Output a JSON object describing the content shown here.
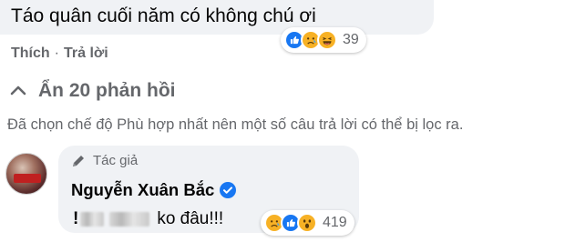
{
  "top_comment": {
    "text": "Táo quân cuối năm có không chú ơi",
    "actions": {
      "like": "Thích",
      "separator": "·",
      "reply": "Trả lời"
    },
    "reactions": {
      "icons": [
        "like-icon",
        "sad-icon",
        "haha-icon"
      ],
      "count": "39"
    }
  },
  "replies_toggle": {
    "icon": "chevron-up-icon",
    "label": "Ẩn 20 phản hồi"
  },
  "filter_notice": "Đã chọn chế độ Phù hợp nhất nên một số câu trả lời có thể bị lọc ra.",
  "reply": {
    "author_tag": "Tác giả",
    "author_name": "Nguyễn Xuân Bắc",
    "verified_icon": "verified-badge-icon",
    "text_visible": "ko đâu!!!",
    "reactions": {
      "icons": [
        "sad-icon",
        "like-icon",
        "wow-icon"
      ],
      "count": "419"
    }
  },
  "colors": {
    "bubble_bg": "#f0f2f5",
    "secondary_text": "#65676b",
    "primary_text": "#050505",
    "facebook_blue": "#1877f2"
  }
}
